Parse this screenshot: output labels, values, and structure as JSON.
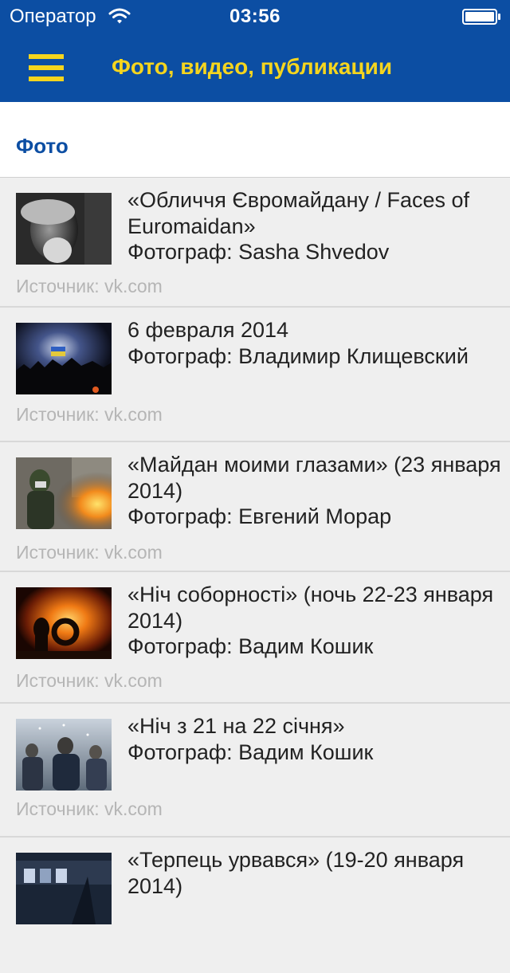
{
  "status_bar": {
    "carrier": "Оператор",
    "time": "03:56",
    "wifi_icon": "wifi-icon",
    "battery_icon": "battery-full-icon"
  },
  "header": {
    "menu_icon": "hamburger-menu-icon",
    "title": "Фото, видео, публикации",
    "background_color": "#0c4ea3",
    "accent_color": "#f5d51e"
  },
  "section": {
    "title": "Фото"
  },
  "items": [
    {
      "title": "«Обличчя Євромайдану / Faces of Euromaidan»",
      "photographer": "Фотограф: Sasha Shvedov",
      "source": "Источник: vk.com"
    },
    {
      "title": "6 февраля 2014",
      "photographer": "Фотограф: Владимир Клищевский",
      "source": "Источник: vk.com"
    },
    {
      "title": "«Майдан моими глазами» (23 января 2014)",
      "photographer": "Фотограф: Евгений Морар",
      "source": "Источник: vk.com"
    },
    {
      "title": "«Ніч соборності» (ночь 22-23 января 2014)",
      "photographer": "Фотограф: Вадим Кошик",
      "source": "Источник: vk.com"
    },
    {
      "title": "«Ніч з 21 на 22 січня»",
      "photographer": "Фотограф: Вадим Кошик",
      "source": "Источник: vk.com"
    },
    {
      "title": "«Терпець урвався» (19-20 января 2014)",
      "photographer": "",
      "source": ""
    }
  ]
}
